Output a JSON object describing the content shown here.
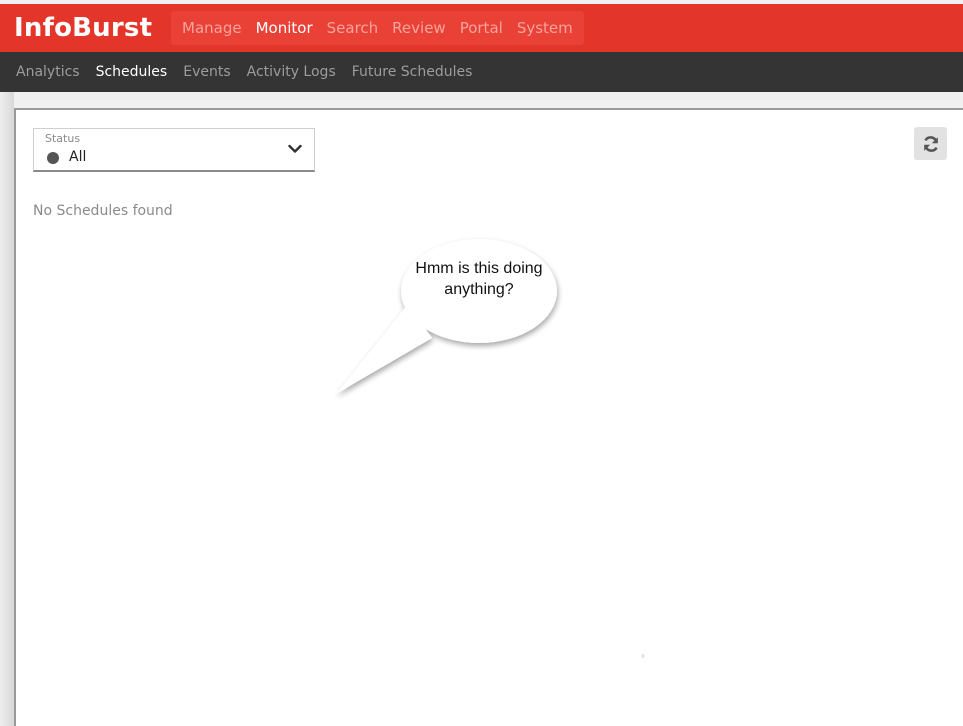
{
  "app": {
    "brand": "InfoBurst"
  },
  "main_nav": {
    "items": [
      {
        "label": "Manage",
        "active": false
      },
      {
        "label": "Monitor",
        "active": true
      },
      {
        "label": "Search",
        "active": false
      },
      {
        "label": "Review",
        "active": false
      },
      {
        "label": "Portal",
        "active": false
      },
      {
        "label": "System",
        "active": false
      }
    ]
  },
  "sub_nav": {
    "items": [
      {
        "label": "Analytics",
        "active": false
      },
      {
        "label": "Schedules",
        "active": true
      },
      {
        "label": "Events",
        "active": false
      },
      {
        "label": "Activity Logs",
        "active": false
      },
      {
        "label": "Future Schedules",
        "active": false
      }
    ]
  },
  "filter": {
    "label": "Status",
    "value": "All",
    "icon": "chevron-down-icon"
  },
  "toolbar": {
    "refresh_icon": "refresh-icon"
  },
  "content": {
    "empty_message": "No Schedules found"
  },
  "annotation": {
    "bubble_text": "Hmm is this doing anything?"
  },
  "colors": {
    "header_red": "#e4352a",
    "subnav_dark": "#343434",
    "status_dot": "#555555"
  }
}
